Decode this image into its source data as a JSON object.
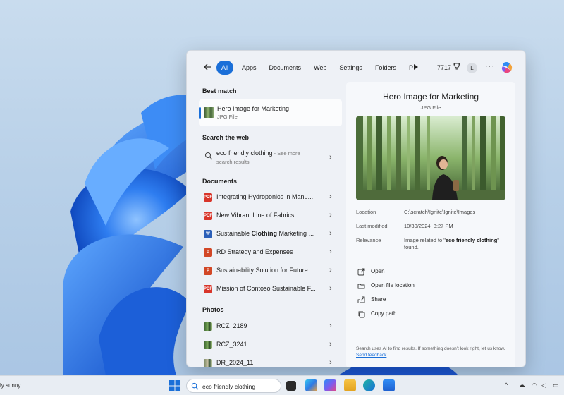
{
  "colors": {
    "accent": "#1a6fd8",
    "wallpaper_bloom": "#1f6fe6",
    "flyout_bg": "#eef1f6"
  },
  "search": {
    "back_icon": "arrow-left-icon",
    "tabs": [
      "All",
      "Apps",
      "Documents",
      "Web",
      "Settings",
      "Folders",
      "P"
    ],
    "active_tab": "All",
    "points": "7717",
    "user_initial": "L",
    "more_label": "···"
  },
  "results": {
    "best_match_header": "Best match",
    "best_match": {
      "title": "Hero Image for Marketing",
      "subtitle": "JPG File"
    },
    "web_header": "Search the web",
    "web_result": {
      "query": "eco friendly clothing",
      "suffix": " - See more",
      "line2": "search results"
    },
    "documents_header": "Documents",
    "documents": [
      {
        "name": "Integrating Hydroponics in Manu...",
        "icon": "pdf-icon",
        "kind": "pdf"
      },
      {
        "name": "New Vibrant Line of Fabrics",
        "icon": "pdf-icon",
        "kind": "pdf"
      },
      {
        "name_prefix": "Sustainable ",
        "name_bold": "Clothing",
        "name_suffix": " Marketing ...",
        "icon": "word-icon",
        "kind": "doc"
      },
      {
        "name": "RD Strategy and Expenses",
        "icon": "powerpoint-icon",
        "kind": "ppt"
      },
      {
        "name": "Sustainability Solution for Future ...",
        "icon": "powerpoint-icon",
        "kind": "ppt"
      },
      {
        "name": "Mission of Contoso Sustainable F...",
        "icon": "pdf-icon",
        "kind": "pdf"
      }
    ],
    "photos_header": "Photos",
    "photos": [
      {
        "name": "RCZ_2189"
      },
      {
        "name": "RCZ_3241"
      },
      {
        "name": "DR_2024_11"
      }
    ]
  },
  "preview": {
    "title": "Hero Image for Marketing",
    "type": "JPG File",
    "location_label": "Location",
    "location_value": "C:\\scratch\\Ignite\\Ignite\\Images",
    "modified_label": "Last modified",
    "modified_value": "10/30/2024, 8:27 PM",
    "relevance_label": "Relevance",
    "relevance_prefix": "Image related to \"",
    "relevance_term": "eco friendly clothing",
    "relevance_suffix": "\" found.",
    "actions": [
      {
        "label": "Open",
        "icon": "open-external-icon"
      },
      {
        "label": "Open file location",
        "icon": "folder-icon"
      },
      {
        "label": "Share",
        "icon": "share-icon"
      },
      {
        "label": "Copy path",
        "icon": "copy-icon"
      }
    ],
    "footer_note": "Search uses AI to find results. If something doesn't look right, let us know. ",
    "footer_link": "Send feedback"
  },
  "taskbar": {
    "weather_text": "ly sunny",
    "search_value": "eco friendly clothing"
  }
}
